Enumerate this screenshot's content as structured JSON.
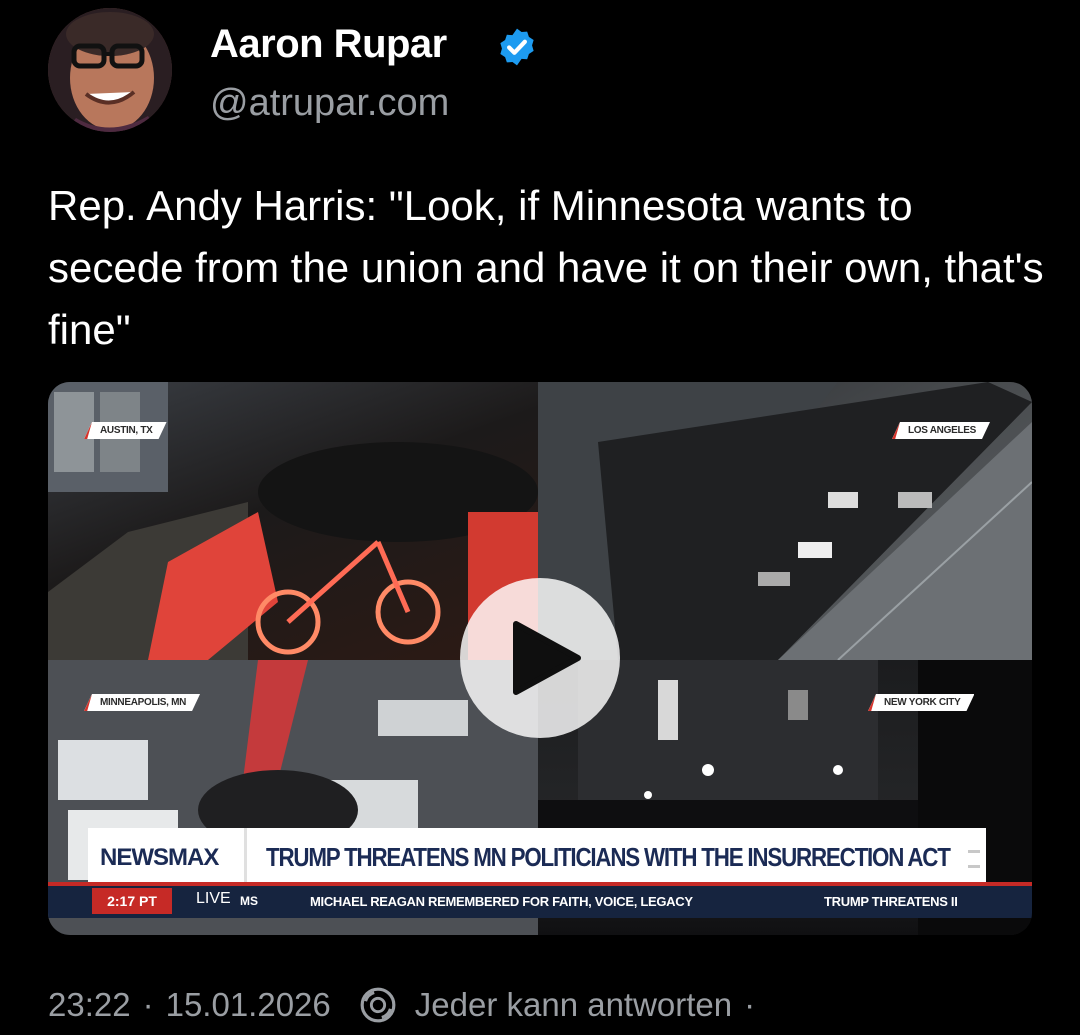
{
  "author": {
    "name": "Aaron Rupar",
    "handle": "@atrupar.com",
    "verified": true,
    "avatar_icon": "profile-photo"
  },
  "post": {
    "text": "Rep. Andy Harris: \"Look, if Minnesota wants to secede from the union and have it on their own, that's fine\""
  },
  "video": {
    "play_icon": "play-icon",
    "locations": [
      "AUSTIN, TX",
      "LOS ANGELES",
      "MINNEAPOLIS, MN",
      "NEW YORK CITY"
    ],
    "broadcast": {
      "network": "NEWSMAX",
      "headline": "TRUMP THREATENS MN POLITICIANS WITH THE INSURRECTION ACT",
      "time": "2:17 PT",
      "live": "LIVE",
      "ticker_fragment": "MS",
      "ticker": "MICHAEL REAGAN REMEMBERED FOR FAITH, VOICE, LEGACY",
      "ticker_next": "TRUMP THREATENS II"
    },
    "colors": {
      "network_blue": "#1b2b55",
      "accent_red": "#c62a26"
    }
  },
  "footer": {
    "time": "23:22",
    "separator": "·",
    "date": "15.01.2026",
    "reply_icon": "reply-settings-icon",
    "reply_setting": "Jeder kann antworten",
    "trailing_separator": "·"
  },
  "colors": {
    "verified_blue": "#1d9bf0",
    "muted_text": "#9a9ea3"
  }
}
